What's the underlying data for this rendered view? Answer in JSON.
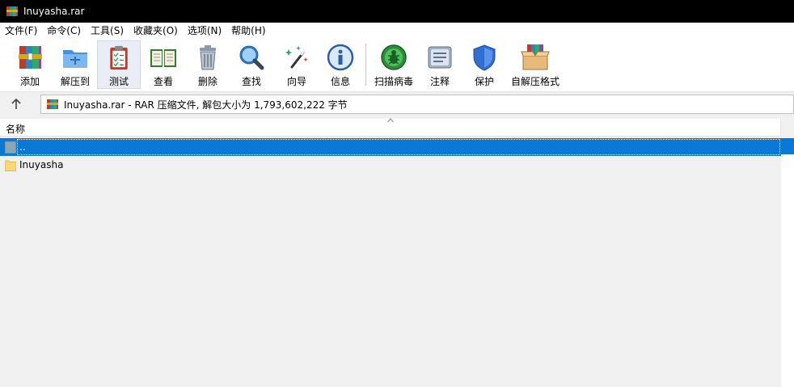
{
  "window": {
    "title": "Inuyasha.rar",
    "icon": "winrar-icon"
  },
  "menu": [
    {
      "label": "文件(F)",
      "name": "menu-file"
    },
    {
      "label": "命令(C)",
      "name": "menu-commands"
    },
    {
      "label": "工具(S)",
      "name": "menu-tools"
    },
    {
      "label": "收藏夹(O)",
      "name": "menu-favorites"
    },
    {
      "label": "选项(N)",
      "name": "menu-options"
    },
    {
      "label": "帮助(H)",
      "name": "menu-help"
    }
  ],
  "toolbar": {
    "add": "添加",
    "extract_to": "解压到",
    "test": "测试",
    "view": "查看",
    "delete": "删除",
    "find": "查找",
    "wizard": "向导",
    "info": "信息",
    "virus_scan": "扫描病毒",
    "comment": "注释",
    "protect": "保护",
    "sfx": "自解压格式"
  },
  "address": {
    "text": "Inuyasha.rar - RAR 压缩文件, 解包大小为 1,793,602,222 字节"
  },
  "columns": {
    "name": "名称"
  },
  "files": [
    {
      "name": "..",
      "selected": true,
      "icon": "parent-folder-icon"
    },
    {
      "name": "Inuyasha",
      "selected": false,
      "icon": "folder-icon"
    }
  ],
  "colors": {
    "selection": "#0a78d7",
    "titlebar": "#000000"
  }
}
